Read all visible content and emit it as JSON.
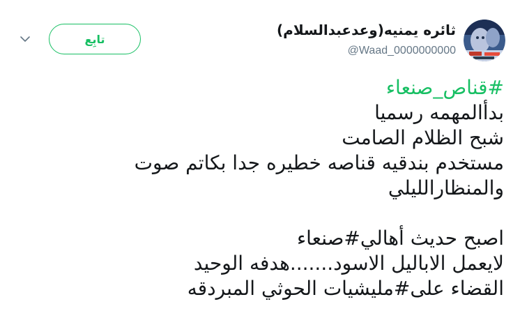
{
  "user": {
    "display_name": "ثائره يمنيه(وعدعبدالسلام)",
    "handle": "@Waad_0000000000"
  },
  "actions": {
    "follow_label": "تابِع"
  },
  "icons": {
    "menu": "chevron-down-icon"
  },
  "colors": {
    "accent": "#17bf63",
    "text": "#14171a",
    "muted": "#657786"
  },
  "tweet": {
    "hashtag_line": "#قناص_صنعاء",
    "line2": "بدأالمهمه رسميا",
    "line3": "شبح الظلام الصامت",
    "line4": "مستخدم بندقيه قناصه خطيره جدا  بكاتم صوت",
    "line5": "والمنظارالليلي",
    "line6": "اصبح حديث أهالي#صنعاء",
    "line7": "لايعمل الاباليل الاسود.......هدفه الوحيد",
    "line8": "القضاء على#مليشيات الحوثي المبردقه"
  }
}
